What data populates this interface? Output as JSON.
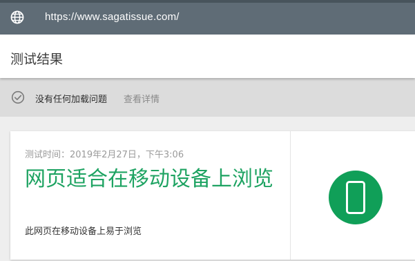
{
  "address_bar": {
    "icon": "globe-icon",
    "url": "https://www.sagatissue.com/"
  },
  "header": {
    "title": "测试结果"
  },
  "status": {
    "icon": "check-circle-icon",
    "text": "没有任何加载问题",
    "details_link": "查看详情"
  },
  "result_card": {
    "timestamp": "测试时间：2019年2月27日，下午3:06",
    "title": "网页适合在移动设备上浏览",
    "description": "此网页在移动设备上易于浏览",
    "badge_icon": "mobile-phone-icon"
  },
  "colors": {
    "top_bar": "#5f6c76",
    "success_green": "#1ea362",
    "badge_green": "#109f58",
    "status_bar": "#dcdcdc"
  }
}
